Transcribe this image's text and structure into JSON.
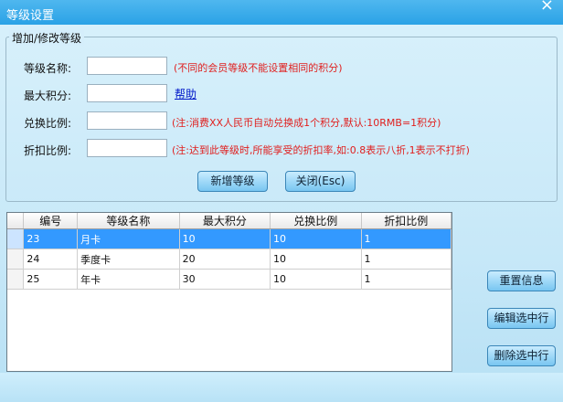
{
  "window": {
    "title": "等级设置",
    "close_glyph": "×"
  },
  "group": {
    "legend": "增加/修改等级"
  },
  "form": {
    "name_label": "等级名称:",
    "name_hint": "(不同的会员等级不能设置相同的积分)",
    "max_points_label": "最大积分:",
    "help_link": "帮助",
    "exchange_label": "兑换比例:",
    "exchange_hint": "(注:消费XX人民币自动兑换成1个积分,默认:10RMB=1积分)",
    "discount_label": "折扣比例:",
    "discount_hint": "(注:达到此等级时,所能享受的折扣率,如:0.8表示八折,1表示不打折)",
    "name_value": "",
    "max_points_value": "",
    "exchange_value": "",
    "discount_value": ""
  },
  "buttons": {
    "add": "新增等级",
    "close": "关闭(Esc)",
    "reset": "重置信息",
    "edit": "编辑选中行",
    "delete": "删除选中行"
  },
  "table": {
    "columns": [
      "编号",
      "等级名称",
      "最大积分",
      "兑换比例",
      "折扣比例"
    ],
    "rows": [
      [
        "23",
        "月卡",
        "10",
        "10",
        "1"
      ],
      [
        "24",
        "季度卡",
        "20",
        "10",
        "1"
      ],
      [
        "25",
        "年卡",
        "30",
        "10",
        "1"
      ]
    ]
  },
  "colors": {
    "title_bar": "#2aa2e6",
    "hint_red": "#e0201f",
    "selection": "#3399ff"
  }
}
